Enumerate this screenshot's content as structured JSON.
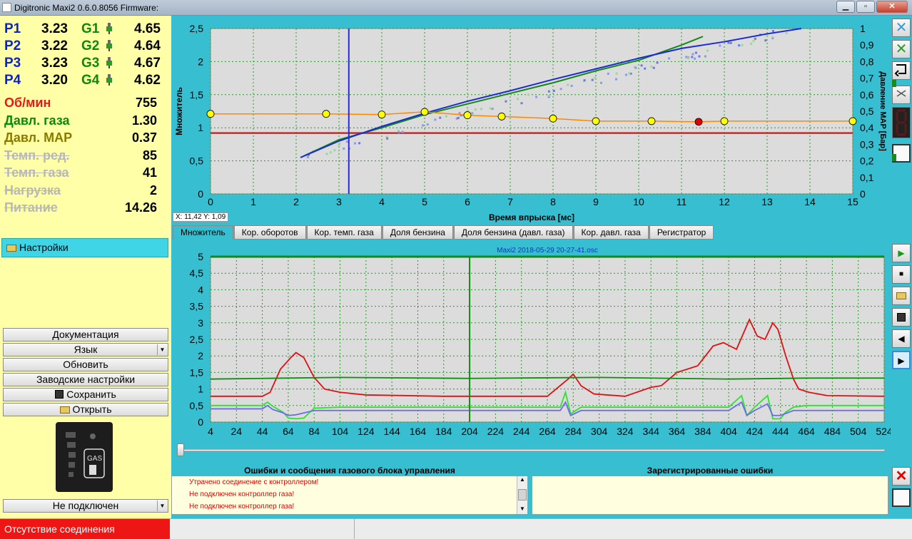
{
  "window": {
    "title": "Digitronic Maxi2 0.6.0.8056 Firmware:",
    "minimize": "▁",
    "maximize": "▫",
    "close": "✕"
  },
  "injectors": [
    {
      "p_label": "P1",
      "p_value": "3.23",
      "g_label": "G1",
      "g_value": "4.65"
    },
    {
      "p_label": "P2",
      "p_value": "3.22",
      "g_label": "G2",
      "g_value": "4.64"
    },
    {
      "p_label": "P3",
      "p_value": "3.23",
      "g_label": "G3",
      "g_value": "4.67"
    },
    {
      "p_label": "P4",
      "p_value": "3.20",
      "g_label": "G4",
      "g_value": "4.62"
    }
  ],
  "params": [
    {
      "label": "Об/мин",
      "value": "755",
      "color": "#e81818",
      "inactive": false
    },
    {
      "label": "Давл. газа",
      "value": "1.30",
      "color": "#0a8a0a",
      "inactive": false
    },
    {
      "label": "Давл. MAP",
      "value": "0.37",
      "color": "#8a7a00",
      "inactive": false
    },
    {
      "label": "Темп. ред.",
      "value": "85",
      "color": "#b8b8b8",
      "inactive": true
    },
    {
      "label": "Темп. газа",
      "value": "41",
      "color": "#b8b8b8",
      "inactive": true
    },
    {
      "label": "Нагрузка",
      "value": "2",
      "color": "#b8b8b8",
      "inactive": true
    },
    {
      "label": "Питание",
      "value": "14.26",
      "color": "#b8b8b8",
      "inactive": true
    }
  ],
  "left_menu": {
    "settings": "Настройки",
    "documentation": "Документация",
    "language": "Язык",
    "update": "Обновить",
    "factory_settings": "Заводские настройки",
    "save": "Сохранить",
    "open": "Открыть",
    "connection_select": "Не подключен"
  },
  "gas_indicator": {
    "label": "GAS",
    "level_segments": 5
  },
  "status": {
    "connection": "Отсутствие соединения"
  },
  "tabs": [
    "Множитель",
    "Кор. оборотов",
    "Кор. темп. газа",
    "Доля бензина",
    "Доля бензина (давл. газа)",
    "Кор. давл. газа",
    "Регистратор"
  ],
  "cursor_readout": {
    "x": "11,42",
    "y": "1,09",
    "text": "X: 11,42  Y: 1,09"
  },
  "chart_data": [
    {
      "type": "scatter",
      "xlabel": "Время впрыска [мс]",
      "ylabel": "Множитель",
      "y2label": "Давление MAP [Бар]",
      "xlim": [
        0,
        15
      ],
      "ylim": [
        0,
        2.5
      ],
      "y2lim": [
        0,
        1
      ],
      "xticks": [
        "0",
        "1",
        "2",
        "3",
        "4",
        "5",
        "6",
        "7",
        "8",
        "9",
        "10",
        "11",
        "12",
        "13",
        "14",
        "15"
      ],
      "yticks": [
        "0",
        "0,5",
        "1",
        "1,5",
        "2",
        "2,5"
      ],
      "y2ticks": [
        "0",
        "0,1",
        "0,2",
        "0,3",
        "0,4",
        "0,5",
        "0,6",
        "0,7",
        "0,8",
        "0,9",
        "1"
      ],
      "grid": true,
      "multiplier_curve": {
        "x": [
          0,
          2.7,
          4,
          5,
          6,
          6.8,
          8,
          9,
          10.3,
          11.4,
          12,
          15
        ],
        "y": [
          1.21,
          1.21,
          1.2,
          1.24,
          1.19,
          1.17,
          1.14,
          1.1,
          1.1,
          1.09,
          1.1,
          1.1
        ]
      },
      "highlight_point": {
        "x": 11.4,
        "y": 1.09
      },
      "reference_line_y": 0.92,
      "vertical_cursor_x": 3.23,
      "blue_trend": {
        "x": [
          2.1,
          3,
          4,
          5,
          6,
          7,
          8,
          9,
          10,
          11,
          12,
          13,
          13.8
        ],
        "y": [
          0.55,
          0.8,
          1.02,
          1.22,
          1.4,
          1.56,
          1.73,
          1.89,
          2.05,
          2.2,
          2.3,
          2.42,
          2.5
        ]
      },
      "green_trend": {
        "x": [
          2.2,
          3,
          4,
          5,
          6,
          7,
          8,
          9,
          10,
          11,
          11.5
        ],
        "y": [
          0.58,
          0.82,
          1.0,
          1.2,
          1.36,
          1.52,
          1.68,
          1.86,
          2.02,
          2.25,
          2.38
        ]
      },
      "colors": {
        "curve": "#ff8800",
        "point": "#ffff00",
        "highlight": "#e00000",
        "reference": "#e02020",
        "cursor": "#2a2ad8",
        "blue": "#1a2ad8",
        "green": "#138a13"
      }
    },
    {
      "type": "line",
      "title": "Maxi2 2018-05-29 20-27-41.osc",
      "xlim": [
        4,
        524
      ],
      "ylim": [
        0,
        5
      ],
      "xticks": [
        "4",
        "24",
        "44",
        "64",
        "84",
        "104",
        "124",
        "144",
        "164",
        "184",
        "204",
        "224",
        "244",
        "264",
        "284",
        "304",
        "324",
        "344",
        "364",
        "384",
        "404",
        "424",
        "444",
        "464",
        "484",
        "504",
        "524"
      ],
      "yticks": [
        "0",
        "0,5",
        "1",
        "1,5",
        "2",
        "2,5",
        "3",
        "3,5",
        "4",
        "4,5",
        "5"
      ],
      "grid": true,
      "marker_x": 204,
      "series": [
        {
          "color": "#e01010",
          "x": [
            4,
            44,
            50,
            58,
            66,
            70,
            76,
            84,
            92,
            104,
            124,
            184,
            264,
            280,
            284,
            290,
            300,
            324,
            344,
            352,
            364,
            380,
            392,
            400,
            410,
            420,
            426,
            432,
            438,
            442,
            448,
            454,
            458,
            466,
            480,
            524
          ],
          "y": [
            0.78,
            0.78,
            0.9,
            1.6,
            1.95,
            2.1,
            1.95,
            1.35,
            1.0,
            0.9,
            0.82,
            0.78,
            0.78,
            1.3,
            1.45,
            1.1,
            0.85,
            0.78,
            1.05,
            1.1,
            1.5,
            1.7,
            2.3,
            2.4,
            2.2,
            3.1,
            2.6,
            2.5,
            3.0,
            2.8,
            2.0,
            1.3,
            1.0,
            0.9,
            0.8,
            0.78
          ]
        },
        {
          "color": "#138a13",
          "x": [
            4,
            44,
            104,
            204,
            304,
            404,
            464,
            524
          ],
          "y": [
            1.3,
            1.32,
            1.35,
            1.32,
            1.35,
            1.3,
            1.33,
            1.33
          ]
        },
        {
          "color": "#30e030",
          "x": [
            4,
            44,
            48,
            52,
            60,
            64,
            70,
            76,
            84,
            104,
            204,
            274,
            278,
            282,
            290,
            304,
            404,
            414,
            418,
            424,
            434,
            438,
            444,
            448,
            454,
            464,
            524
          ],
          "y": [
            0.5,
            0.5,
            0.6,
            0.48,
            0.3,
            0.12,
            0.1,
            0.12,
            0.42,
            0.45,
            0.45,
            0.45,
            0.9,
            0.25,
            0.45,
            0.45,
            0.45,
            0.8,
            0.2,
            0.45,
            0.8,
            0.1,
            0.1,
            0.3,
            0.45,
            0.5,
            0.5
          ]
        },
        {
          "color": "#6a6aef",
          "x": [
            4,
            44,
            48,
            52,
            60,
            64,
            70,
            84,
            104,
            204,
            274,
            278,
            282,
            290,
            304,
            404,
            414,
            418,
            424,
            434,
            438,
            444,
            454,
            524
          ],
          "y": [
            0.4,
            0.4,
            0.5,
            0.38,
            0.28,
            0.2,
            0.22,
            0.35,
            0.35,
            0.35,
            0.35,
            0.6,
            0.2,
            0.35,
            0.35,
            0.35,
            0.6,
            0.2,
            0.35,
            0.55,
            0.2,
            0.2,
            0.35,
            0.35
          ]
        }
      ]
    }
  ],
  "errors_panel": {
    "title": "Ошибки и сообщения газового блока управления",
    "messages": [
      "Утрачено соединение с контроллером!",
      "Не подключен контроллер газа!",
      "Не подключен контроллер газа!"
    ]
  },
  "registered_errors": {
    "title": "Зарегистрированные ошибки"
  }
}
